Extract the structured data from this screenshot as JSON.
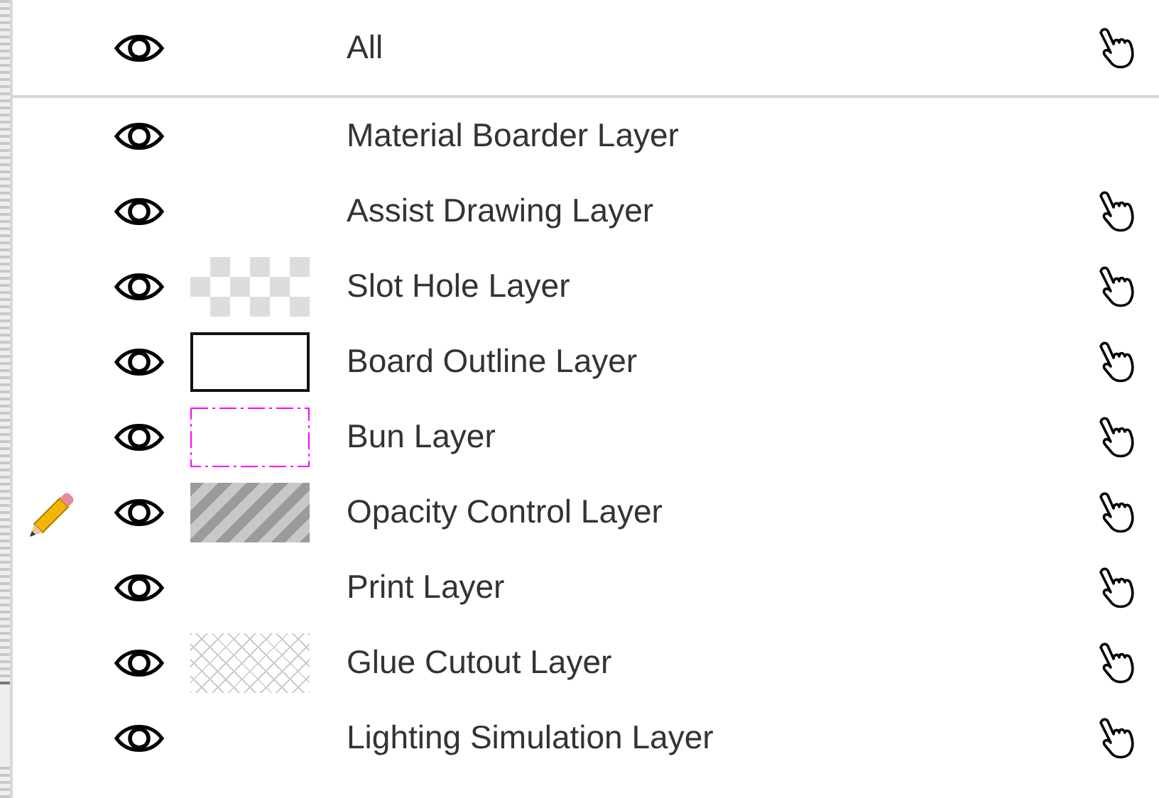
{
  "all_row": {
    "label": "All",
    "visible": true,
    "pickable": true
  },
  "layers": [
    {
      "name": "Material Boarder Layer",
      "visible": true,
      "editing": false,
      "pickable": false,
      "kind": "plain"
    },
    {
      "name": "Assist Drawing Layer",
      "visible": true,
      "editing": false,
      "pickable": true,
      "kind": "plain"
    },
    {
      "name": "Slot Hole Layer",
      "visible": true,
      "editing": false,
      "pickable": true,
      "kind": "checker"
    },
    {
      "name": "Board Outline Layer",
      "visible": true,
      "editing": false,
      "pickable": true,
      "kind": "outline"
    },
    {
      "name": "Bun Layer",
      "visible": true,
      "editing": false,
      "pickable": true,
      "kind": "dashdot"
    },
    {
      "name": "Opacity Control Layer",
      "visible": true,
      "editing": true,
      "pickable": true,
      "kind": "stripes"
    },
    {
      "name": "Print Layer",
      "visible": true,
      "editing": false,
      "pickable": true,
      "kind": "plain"
    },
    {
      "name": "Glue Cutout Layer",
      "visible": true,
      "editing": false,
      "pickable": true,
      "kind": "crosshatch"
    },
    {
      "name": "Lighting Simulation Layer",
      "visible": true,
      "editing": false,
      "pickable": true,
      "kind": "plain"
    }
  ]
}
